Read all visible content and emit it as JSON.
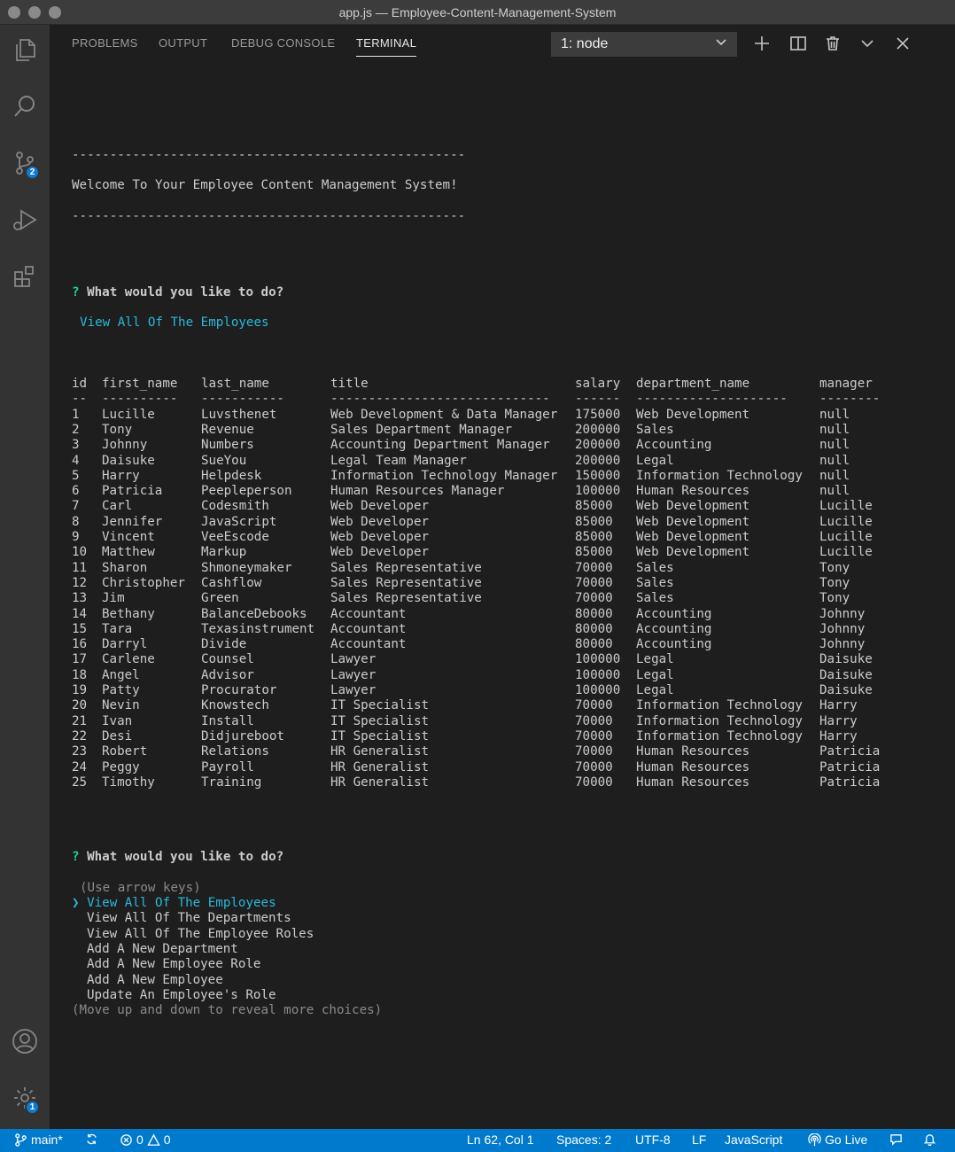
{
  "window": {
    "title": "app.js — Employee-Content-Management-System"
  },
  "activity_bar": {
    "scm_badge": "2",
    "settings_badge": "1"
  },
  "panel": {
    "tabs": [
      "PROBLEMS",
      "OUTPUT",
      "DEBUG CONSOLE",
      "TERMINAL"
    ],
    "active_tab": "TERMINAL",
    "terminal_select": "1: node"
  },
  "terminal": {
    "rule": "----------------------------------------------------",
    "welcome": "Welcome To Your Employee Content Management System!",
    "prompt_mark": "?",
    "question": "What would you like to do?",
    "answer": "View All Of The Employees",
    "table": {
      "headers": [
        "id",
        "first_name",
        "last_name",
        "title",
        "salary",
        "department_name",
        "manager"
      ],
      "separators": [
        "--",
        "----------",
        "-----------",
        "-----------------------------",
        "------",
        "--------------------",
        "--------"
      ],
      "rows": [
        [
          "1",
          "Lucille",
          "Luvsthenet",
          "Web Development & Data Manager",
          "175000",
          "Web Development",
          "null"
        ],
        [
          "2",
          "Tony",
          "Revenue",
          "Sales Department Manager",
          "200000",
          "Sales",
          "null"
        ],
        [
          "3",
          "Johnny",
          "Numbers",
          "Accounting Department Manager",
          "200000",
          "Accounting",
          "null"
        ],
        [
          "4",
          "Daisuke",
          "SueYou",
          "Legal Team Manager",
          "200000",
          "Legal",
          "null"
        ],
        [
          "5",
          "Harry",
          "Helpdesk",
          "Information Technology Manager",
          "150000",
          "Information Technology",
          "null"
        ],
        [
          "6",
          "Patricia",
          "Peepleperson",
          "Human Resources Manager",
          "100000",
          "Human Resources",
          "null"
        ],
        [
          "7",
          "Carl",
          "Codesmith",
          "Web Developer",
          "85000",
          "Web Development",
          "Lucille"
        ],
        [
          "8",
          "Jennifer",
          "JavaScript",
          "Web Developer",
          "85000",
          "Web Development",
          "Lucille"
        ],
        [
          "9",
          "Vincent",
          "VeeEscode",
          "Web Developer",
          "85000",
          "Web Development",
          "Lucille"
        ],
        [
          "10",
          "Matthew",
          "Markup",
          "Web Developer",
          "85000",
          "Web Development",
          "Lucille"
        ],
        [
          "11",
          "Sharon",
          "Shmoneymaker",
          "Sales Representative",
          "70000",
          "Sales",
          "Tony"
        ],
        [
          "12",
          "Christopher",
          "Cashflow",
          "Sales Representative",
          "70000",
          "Sales",
          "Tony"
        ],
        [
          "13",
          "Jim",
          "Green",
          "Sales Representative",
          "70000",
          "Sales",
          "Tony"
        ],
        [
          "14",
          "Bethany",
          "BalanceDebooks",
          "Accountant",
          "80000",
          "Accounting",
          "Johnny"
        ],
        [
          "15",
          "Tara",
          "Texasinstrument",
          "Accountant",
          "80000",
          "Accounting",
          "Johnny"
        ],
        [
          "16",
          "Darryl",
          "Divide",
          "Accountant",
          "80000",
          "Accounting",
          "Johnny"
        ],
        [
          "17",
          "Carlene",
          "Counsel",
          "Lawyer",
          "100000",
          "Legal",
          "Daisuke"
        ],
        [
          "18",
          "Angel",
          "Advisor",
          "Lawyer",
          "100000",
          "Legal",
          "Daisuke"
        ],
        [
          "19",
          "Patty",
          "Procurator",
          "Lawyer",
          "100000",
          "Legal",
          "Daisuke"
        ],
        [
          "20",
          "Nevin",
          "Knowstech",
          "IT Specialist",
          "70000",
          "Information Technology",
          "Harry"
        ],
        [
          "21",
          "Ivan",
          "Install",
          "IT Specialist",
          "70000",
          "Information Technology",
          "Harry"
        ],
        [
          "22",
          "Desi",
          "Didjureboot",
          "IT Specialist",
          "70000",
          "Information Technology",
          "Harry"
        ],
        [
          "23",
          "Robert",
          "Relations",
          "HR Generalist",
          "70000",
          "Human Resources",
          "Patricia"
        ],
        [
          "24",
          "Peggy",
          "Payroll",
          "HR Generalist",
          "70000",
          "Human Resources",
          "Patricia"
        ],
        [
          "25",
          "Timothy",
          "Training",
          "HR Generalist",
          "70000",
          "Human Resources",
          "Patricia"
        ]
      ]
    },
    "second_question": "What would you like to do?",
    "hint": "(Use arrow keys)",
    "pointer": "❯",
    "choices": [
      "View All Of The Employees",
      "View All Of The Departments",
      "View All Of The Employee Roles",
      "Add A New Department",
      "Add A New Employee Role",
      "Add A New Employee",
      "Update An Employee's Role"
    ],
    "more_hint": "(Move up and down to reveal more choices)"
  },
  "status_bar": {
    "branch": "main*",
    "errors": "0",
    "warnings": "0",
    "cursor": "Ln 62, Col 1",
    "spaces": "Spaces: 2",
    "encoding": "UTF-8",
    "eol": "LF",
    "language": "JavaScript",
    "go_live": "Go Live"
  },
  "colors": {
    "status_bar": "#007acc",
    "prompt_green": "#23d18b",
    "answer_cyan": "#29b8db",
    "badge_blue": "#0e7ad1"
  }
}
